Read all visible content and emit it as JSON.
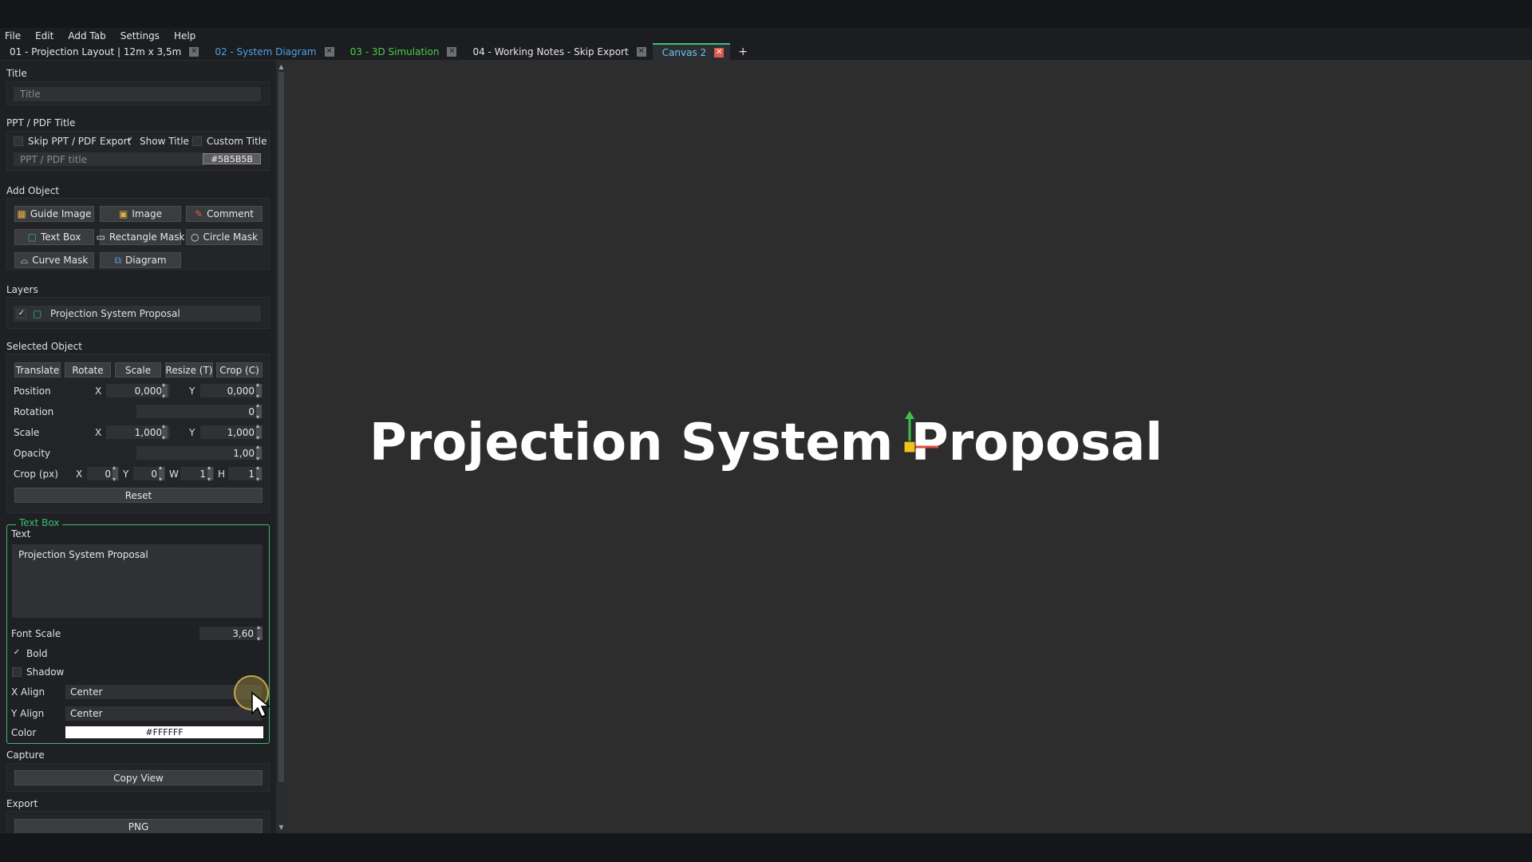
{
  "menu": [
    "File",
    "Edit",
    "Add Tab",
    "Settings",
    "Help"
  ],
  "tabs": [
    {
      "label": "01 - Projection Layout | 12m x 3,5m",
      "style": "normal"
    },
    {
      "label": "02 - System Diagram",
      "style": "blue"
    },
    {
      "label": "03 - 3D Simulation",
      "style": "green"
    },
    {
      "label": "04 - Working Notes - Skip Export",
      "style": "normal"
    },
    {
      "label": "Canvas 2",
      "style": "active"
    }
  ],
  "tab_add": "+",
  "title_section": {
    "heading": "Title",
    "placeholder": "Title"
  },
  "ppt_section": {
    "heading": "PPT / PDF Title",
    "skip_label": "Skip PPT / PDF Export",
    "show_title_label": "Show Title",
    "custom_title_label": "Custom Title",
    "title_placeholder": "PPT / PDF title",
    "color_value": "#5B5B5B"
  },
  "add_object": {
    "heading": "Add Object",
    "buttons": [
      "Guide Image",
      "Image",
      "Comment",
      "Text Box",
      "Rectangle Mask",
      "Circle Mask",
      "Curve Mask",
      "Diagram"
    ]
  },
  "layers": {
    "heading": "Layers",
    "items": [
      "Projection System Proposal"
    ]
  },
  "selected_object": {
    "heading": "Selected Object",
    "modes": [
      "Translate",
      "Rotate",
      "Scale",
      "Resize (T)",
      "Crop (C)"
    ],
    "position_label": "Position",
    "position_x": "0,000",
    "position_y": "0,000",
    "rotation_label": "Rotation",
    "rotation": "0",
    "scale_label": "Scale",
    "scale_x": "1,000",
    "scale_y": "1,000",
    "opacity_label": "Opacity",
    "opacity": "1,00",
    "crop_label": "Crop (px)",
    "crop_x": "0",
    "crop_y": "0",
    "crop_w": "1",
    "crop_h": "1",
    "x_label": "X",
    "y_label": "Y",
    "w_label": "W",
    "h_label": "H",
    "reset_label": "Reset"
  },
  "text_box": {
    "legend": "Text Box",
    "text_label": "Text",
    "text_value": "Projection System Proposal",
    "font_scale_label": "Font Scale",
    "font_scale": "3,60",
    "bold_label": "Bold",
    "shadow_label": "Shadow",
    "x_align_label": "X Align",
    "x_align": "Center",
    "y_align_label": "Y Align",
    "y_align": "Center",
    "color_label": "Color",
    "color_value": "#FFFFFF"
  },
  "capture": {
    "heading": "Capture",
    "copy_label": "Copy View"
  },
  "export": {
    "heading": "Export",
    "png_label": "PNG"
  },
  "canvas": {
    "text": "Projection System Proposal"
  },
  "colors": {
    "accent_green": "#3dbd6e",
    "tab_blue": "#4ea3e4",
    "tab_green": "#4ad04a",
    "close_red": "#e05a4e"
  }
}
